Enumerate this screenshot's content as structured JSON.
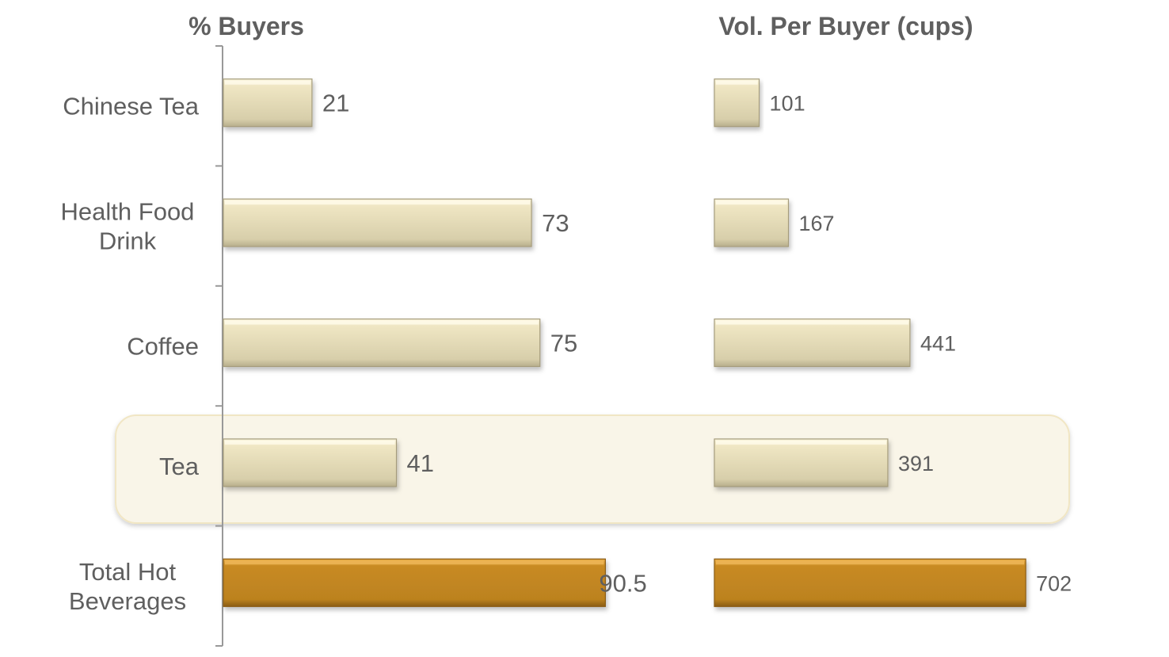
{
  "chart_data": {
    "type": "bar",
    "orientation": "horizontal",
    "categories": [
      "Chinese Tea",
      "Health Food Drink",
      "Coffee",
      "Tea",
      "Total Hot Beverages"
    ],
    "category_lines": [
      [
        "Chinese Tea"
      ],
      [
        "Health Food",
        "Drink"
      ],
      [
        "Coffee"
      ],
      [
        "Tea"
      ],
      [
        "Total Hot",
        "Beverages"
      ]
    ],
    "highlighted_category": "Tea",
    "total_category": "Total Hot Beverages",
    "grid": false,
    "legend": "none",
    "panels": [
      {
        "title": "% Buyers",
        "values": [
          21,
          73,
          75,
          41,
          90.5
        ],
        "labels": [
          "21",
          "73",
          "75",
          "41",
          "90.5"
        ],
        "xlim": [
          0,
          100
        ]
      },
      {
        "title": "Vol. Per Buyer (cups)",
        "values": [
          101,
          167,
          441,
          391,
          702
        ],
        "labels": [
          "101",
          "167",
          "441",
          "391",
          "702"
        ],
        "xlim": [
          0,
          800
        ]
      }
    ],
    "colors": {
      "bar": "#e6dcb6",
      "bar_total": "#c0841f",
      "highlight_band": "#f9f5e8",
      "text": "#5f5f5f",
      "axis": "#999999"
    }
  }
}
